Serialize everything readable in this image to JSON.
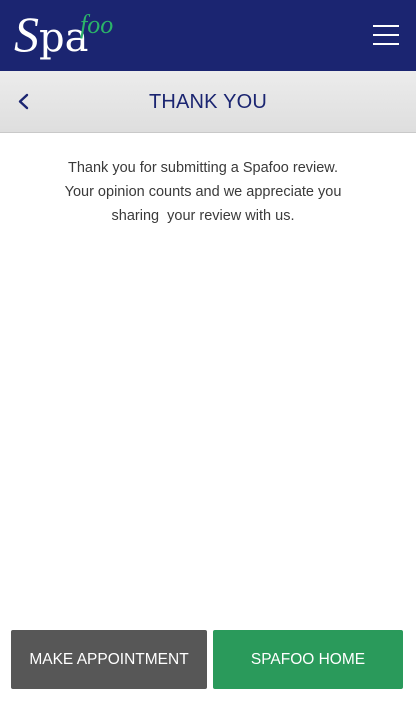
{
  "header": {
    "logo": {
      "primary_text": "Spa",
      "accent_text": "foo",
      "primary_color": "#ffffff",
      "accent_color": "#2bb469"
    },
    "menu_icon": "hamburger-icon",
    "background_color": "#1b2571"
  },
  "titlebar": {
    "back_icon": "chevron-left-icon",
    "title": "THANK YOU"
  },
  "message": {
    "lines": [
      "Thank you for submitting a Spafoo review.",
      "Your opinion counts and we appreciate you",
      "sharing  your review with us."
    ]
  },
  "buttons": {
    "appointment_label": "MAKE APPOINTMENT",
    "appointment_color": "#575757",
    "home_label": "SPAFOO HOME",
    "home_color": "#2a9a5b"
  }
}
